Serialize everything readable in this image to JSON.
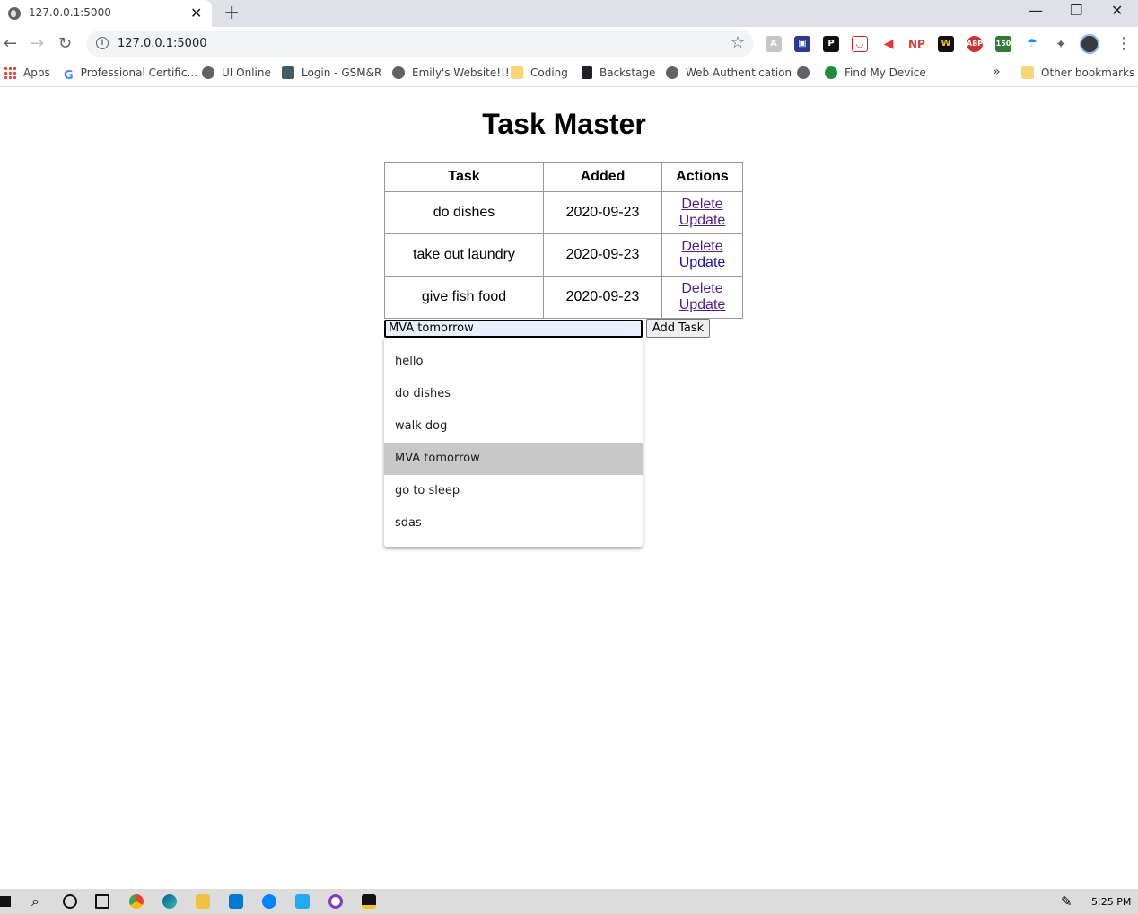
{
  "browser": {
    "tab_title": "127.0.0.1:5000",
    "url": "127.0.0.1:5000",
    "new_tab_symbol": "+",
    "close_symbol": "✕",
    "bookmarks": [
      {
        "label": "Apps",
        "icon": "apps-grid-icon"
      },
      {
        "label": "Professional Certific...",
        "icon": "google-icon"
      },
      {
        "label": "UI Online",
        "icon": "globe-icon"
      },
      {
        "label": "Login - GSM&R",
        "icon": "site-icon"
      },
      {
        "label": "Emily's Website!!!",
        "icon": "globe-icon"
      },
      {
        "label": "Coding",
        "icon": "folder-icon"
      },
      {
        "label": "Backstage",
        "icon": "backstage-icon"
      },
      {
        "label": "Web Authentication",
        "icon": "globe-icon"
      },
      {
        "label": "",
        "icon": "globe-icon"
      },
      {
        "label": "Find My Device",
        "icon": "find-device-icon"
      }
    ],
    "overflow_symbol": "»",
    "other_bookmarks": "Other bookmarks"
  },
  "page": {
    "title": "Task Master",
    "table": {
      "headers": [
        "Task",
        "Added",
        "Actions"
      ],
      "rows": [
        {
          "task": "do dishes",
          "added": "2020-09-23",
          "delete": "Delete",
          "update": "Update"
        },
        {
          "task": "take out laundry",
          "added": "2020-09-23",
          "delete": "Delete",
          "update": "Update"
        },
        {
          "task": "give fish food",
          "added": "2020-09-23",
          "delete": "Delete",
          "update": "Update"
        }
      ]
    },
    "form": {
      "input_value": "MVA tomorrow",
      "button_label": "Add Task"
    },
    "autocomplete": {
      "options": [
        "hello",
        "do dishes",
        "walk dog",
        "MVA tomorrow",
        "go to sleep",
        "sdas"
      ],
      "selected": "MVA tomorrow"
    }
  },
  "taskbar": {
    "time": "5:25 PM"
  }
}
